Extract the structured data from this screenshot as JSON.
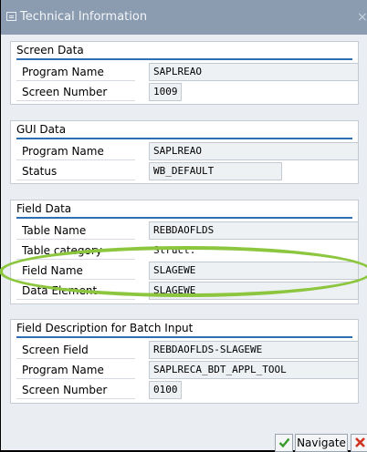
{
  "window": {
    "title": "Technical Information",
    "close_glyph": "×"
  },
  "groups": {
    "screen_data": {
      "title": "Screen Data",
      "rows": [
        {
          "label": "Program Name",
          "value": "SAPLREAO"
        },
        {
          "label": "Screen Number",
          "value": "1009"
        }
      ]
    },
    "gui_data": {
      "title": "GUI Data",
      "rows": [
        {
          "label": "Program Name",
          "value": "SAPLREAO"
        },
        {
          "label": "Status",
          "value": "WB_DEFAULT"
        }
      ]
    },
    "field_data": {
      "title": "Field Data",
      "rows": [
        {
          "label": "Table Name",
          "value": "REBDAOFLDS"
        },
        {
          "label": "Table category",
          "value": "Struct."
        },
        {
          "label": "Field Name",
          "value": "SLAGEWE"
        },
        {
          "label": "Data Element",
          "value": "SLAGEWE"
        }
      ]
    },
    "batch_input": {
      "title": "Field Description for Batch Input",
      "rows": [
        {
          "label": "Screen Field",
          "value": "REBDAOFLDS-SLAGEWE"
        },
        {
          "label": "Program Name",
          "value": "SAPLRECA_BDT_APPL_TOOL"
        },
        {
          "label": "Screen Number",
          "value": "0100"
        }
      ]
    }
  },
  "footer": {
    "navigate_label": "Navigate"
  },
  "colors": {
    "highlight_ellipse": "#8cc63f",
    "section_rule": "#2e6fb4",
    "titlebar": "#8b9cb0"
  }
}
